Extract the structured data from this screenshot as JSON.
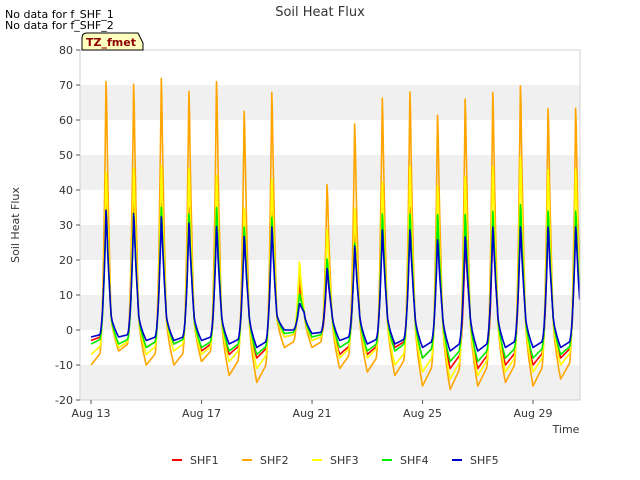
{
  "notes": [
    "No data for f_SHF_1",
    "No data for f_SHF_2"
  ],
  "chart_data": {
    "type": "line",
    "title": "Soil Heat Flux",
    "xlabel": "Time",
    "ylabel": "Soil Heat Flux",
    "timezone_badge": "TZ_fmet",
    "xlim_days": [
      12.6,
      30.7
    ],
    "ylim": [
      -20,
      80
    ],
    "yticks": [
      -20,
      -10,
      0,
      10,
      20,
      30,
      40,
      50,
      60,
      70,
      80
    ],
    "xticks": [
      {
        "day": 13,
        "label": "Aug 13"
      },
      {
        "day": 17,
        "label": "Aug 17"
      },
      {
        "day": 21,
        "label": "Aug 21"
      },
      {
        "day": 25,
        "label": "Aug 25"
      },
      {
        "day": 29,
        "label": "Aug 29"
      }
    ],
    "grid": "horizontal bands",
    "legend_position": "bottom",
    "days": [
      13,
      14,
      15,
      16,
      17,
      18,
      19,
      20,
      21,
      22,
      23,
      24,
      25,
      26,
      27,
      28,
      29,
      30
    ],
    "series": [
      {
        "name": "SHF1",
        "color": "#ff0000",
        "daily_peak": [
          42,
          43,
          44,
          38,
          38,
          36,
          40,
          14,
          19,
          30,
          38,
          38,
          36,
          28,
          33,
          38,
          36,
          36
        ],
        "daily_min": [
          -3,
          -5,
          -5,
          -4,
          -6,
          -7,
          -8,
          -2,
          -3,
          -7,
          -7,
          -5,
          -8,
          -11,
          -11,
          -10,
          -10,
          -8
        ]
      },
      {
        "name": "SHF2",
        "color": "#ffa500",
        "daily_peak": [
          77,
          76,
          78,
          74,
          77,
          68,
          74,
          17,
          45,
          64,
          72,
          74,
          67,
          72,
          74,
          76,
          69,
          69
        ],
        "daily_min": [
          -10,
          -6,
          -10,
          -10,
          -9,
          -13,
          -15,
          -5,
          -5,
          -11,
          -12,
          -13,
          -16,
          -17,
          -16,
          -15,
          -16,
          -14
        ]
      },
      {
        "name": "SHF3",
        "color": "#ffff00",
        "daily_peak": [
          49,
          50,
          51,
          50,
          48,
          38,
          47,
          21,
          31,
          38,
          46,
          51,
          45,
          48,
          51,
          54,
          50,
          50
        ],
        "daily_min": [
          -7,
          -5,
          -7,
          -6,
          -7,
          -9,
          -11,
          -2,
          -3,
          -8,
          -8,
          -10,
          -12,
          -14,
          -13,
          -12,
          -12,
          -10
        ]
      },
      {
        "name": "SHF4",
        "color": "#00ee00",
        "daily_peak": [
          37,
          36,
          38,
          36,
          38,
          32,
          35,
          11,
          22,
          27,
          36,
          36,
          36,
          36,
          37,
          39,
          37,
          37
        ],
        "daily_min": [
          -4,
          -4,
          -5,
          -4,
          -5,
          -6,
          -7,
          -1,
          -2,
          -5,
          -6,
          -6,
          -8,
          -9,
          -9,
          -8,
          -8,
          -7
        ]
      },
      {
        "name": "SHF5",
        "color": "#0000cc",
        "daily_peak": [
          37,
          36,
          35,
          33,
          32,
          29,
          32,
          8,
          19,
          26,
          31,
          31,
          28,
          29,
          32,
          32,
          32,
          32
        ],
        "daily_min": [
          -2,
          -2,
          -3,
          -3,
          -3,
          -4,
          -5,
          0,
          -1,
          -3,
          -4,
          -4,
          -5,
          -6,
          -6,
          -5,
          -5,
          -5
        ]
      }
    ]
  }
}
